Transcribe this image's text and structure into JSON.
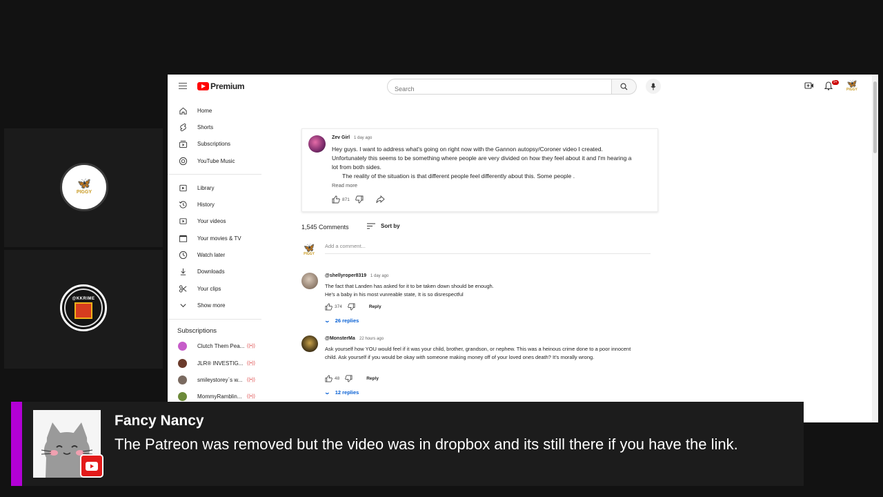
{
  "yt": {
    "logo_text": "Premium",
    "search_placeholder": "Search",
    "notification_count": "9+",
    "account_label": "PIGGY"
  },
  "sidebar": {
    "items": [
      {
        "label": "Home",
        "icon": "home-icon"
      },
      {
        "label": "Shorts",
        "icon": "shorts-icon"
      },
      {
        "label": "Subscriptions",
        "icon": "subscriptions-icon"
      },
      {
        "label": "YouTube Music",
        "icon": "music-icon"
      },
      {
        "label": "Library",
        "icon": "library-icon"
      },
      {
        "label": "History",
        "icon": "history-icon"
      },
      {
        "label": "Your videos",
        "icon": "your-videos-icon"
      },
      {
        "label": "Your movies & TV",
        "icon": "movies-icon"
      },
      {
        "label": "Watch later",
        "icon": "clock-icon"
      },
      {
        "label": "Downloads",
        "icon": "download-icon"
      },
      {
        "label": "Your clips",
        "icon": "scissors-icon"
      },
      {
        "label": "Show more",
        "icon": "chevron-down-icon"
      }
    ],
    "subscriptions_heading": "Subscriptions",
    "subscriptions": [
      {
        "label": "Clutch Them Pea...",
        "color": "#c65cc9"
      },
      {
        "label": "JLR® INVESTIG...",
        "color": "#6b3b2b"
      },
      {
        "label": "smileystorey`s w...",
        "color": "#7a6a60"
      },
      {
        "label": "MommyRamblin...",
        "color": "#6d8a3a"
      }
    ],
    "live_marker": "((•))"
  },
  "pinned": {
    "author": "Zev Girl",
    "time": "1 day ago",
    "body_line1": "Hey guys. I want to address what's going on right now with the Gannon autopsy/Coroner video I created.  Unfortunately this seems to be something where people are very divided on how they feel about it and I'm hearing a lot from both sides.",
    "body_line2": "The reality of the situation is that different people feel differently about this. Some people .",
    "read_more": "Read more",
    "likes": "871"
  },
  "comments_header": {
    "count": "1,545 Comments",
    "sort": "Sort by",
    "add_placeholder": "Add a comment..."
  },
  "comments": [
    {
      "author": "@shellyroper8319",
      "time": "1 day ago",
      "body": "The fact that Landen has asked for it to be taken down should be enough.\nHe's a baby in his most vunreable state, It is so disrespectful",
      "likes": "374",
      "reply": "Reply",
      "replies": "26 replies"
    },
    {
      "author": "@MonsterMa",
      "time": "22 hours ago",
      "body": "Ask yourself how YOU would feel if it was your child, brother, grandson, or nephew. This was a heinous crime done to a poor innocent child.  Ask yourself if you would be okay with someone making money off of your loved ones death? It's morally wrong.",
      "likes": "48",
      "reply": "Reply",
      "replies": "12 replies"
    }
  ],
  "chat": {
    "name": "Fancy Nancy",
    "message": "The Patreon was removed but the video was in dropbox and its still there if you have the link."
  },
  "guests": [
    {
      "label": "PIGGY"
    },
    {
      "label": "@KKRIME"
    }
  ],
  "colors": {
    "accent_purple": "#b300d6",
    "youtube_red": "#ff0000",
    "link_blue": "#065fd4"
  }
}
